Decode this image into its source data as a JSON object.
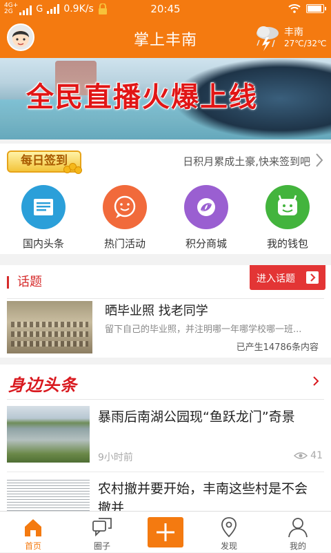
{
  "status_bar": {
    "network_top": "4G+",
    "network_bottom": "2G",
    "carrier_g": "G",
    "speed": "0.9K/s",
    "time": "20:45"
  },
  "header": {
    "title": "掌上丰南",
    "weather_city": "丰南",
    "weather_temp": "27℃/32℃"
  },
  "banner": {
    "slogan": "全民直播火爆上线"
  },
  "signin": {
    "badge": "每日签到",
    "hint": "日积月累成土豪,快来签到吧"
  },
  "quick_links": [
    {
      "label": "国内头条",
      "icon": "newspaper-icon",
      "color": "#2b9fd9"
    },
    {
      "label": "热门活动",
      "icon": "smile-chat-icon",
      "color": "#f16a3b"
    },
    {
      "label": "积分商城",
      "icon": "swirl-icon",
      "color": "#9a5fd1"
    },
    {
      "label": "我的钱包",
      "icon": "wallet-face-icon",
      "color": "#43b43d"
    }
  ],
  "topic": {
    "heading": "话题",
    "enter_label": "进入话题",
    "title": "晒毕业照 找老同学",
    "desc": "留下自己的毕业照，并注明哪一年哪学校哪一班...",
    "count": "已产生14786条内容"
  },
  "local_news": {
    "heading": "身边头条",
    "items": [
      {
        "title": "暴雨后南湖公园现“鱼跃龙门”奇景",
        "time": "9小时前",
        "views": "41"
      },
      {
        "title": "农村撤并要开始，丰南这些村是不会撤并",
        "time": "",
        "views": ""
      }
    ]
  },
  "tabbar": {
    "tabs": [
      {
        "label": "首页",
        "icon": "home-icon",
        "active": true
      },
      {
        "label": "圈子",
        "icon": "chat-bubbles-icon",
        "active": false
      },
      {
        "label": "发现",
        "icon": "location-pin-icon",
        "active": false
      },
      {
        "label": "我的",
        "icon": "person-icon",
        "active": false
      }
    ]
  },
  "colors": {
    "brand": "#f47a10",
    "accent_red": "#e33535"
  }
}
